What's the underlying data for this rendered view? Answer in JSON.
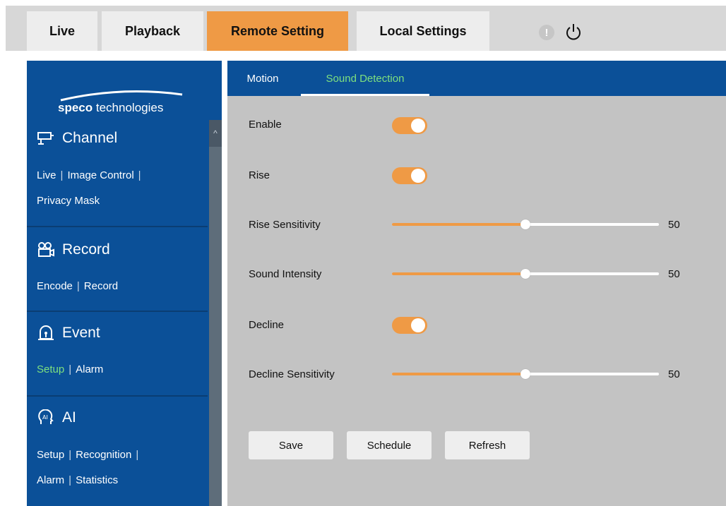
{
  "topnav": {
    "tabs": [
      "Live",
      "Playback",
      "Remote Setting",
      "Local Settings"
    ],
    "active_tab": "Remote Setting",
    "warning_glyph": "!",
    "icons": [
      "warning-icon",
      "power-icon"
    ]
  },
  "sidebar": {
    "logo": {
      "brand": "speco",
      "suffix": "technologies"
    },
    "scroll_glyph": "^",
    "sections": [
      {
        "title": "Channel",
        "icon": "camera-icon",
        "links": [
          "Live",
          "Image Control",
          "Privacy Mask"
        ]
      },
      {
        "title": "Record",
        "icon": "record-icon",
        "links": [
          "Encode",
          "Record"
        ]
      },
      {
        "title": "Event",
        "icon": "alarm-light-icon",
        "links": [
          "Setup",
          "Alarm"
        ],
        "active_link": "Setup"
      },
      {
        "title": "AI",
        "icon": "ai-head-icon",
        "links": [
          "Setup",
          "Recognition",
          "Alarm",
          "Statistics"
        ]
      }
    ],
    "separator": "|"
  },
  "content": {
    "subtabs": [
      "Motion",
      "Sound Detection"
    ],
    "active_subtab": "Sound Detection",
    "settings": {
      "enable": {
        "label": "Enable",
        "on": true
      },
      "rise": {
        "label": "Rise",
        "on": true
      },
      "rise_sensitivity": {
        "label": "Rise Sensitivity",
        "value": "50",
        "fraction": 0.5
      },
      "sound_intensity": {
        "label": "Sound Intensity",
        "value": "50",
        "fraction": 0.5
      },
      "decline": {
        "label": "Decline",
        "on": true
      },
      "decline_sensitivity": {
        "label": "Decline Sensitivity",
        "value": "50",
        "fraction": 0.5
      }
    },
    "buttons": {
      "save": "Save",
      "schedule": "Schedule",
      "refresh": "Refresh"
    }
  },
  "colors": {
    "accent": "#ef9a45",
    "sidebar": "#0b5098",
    "active_link": "#7ee07e",
    "content_bg": "#c3c3c3"
  }
}
